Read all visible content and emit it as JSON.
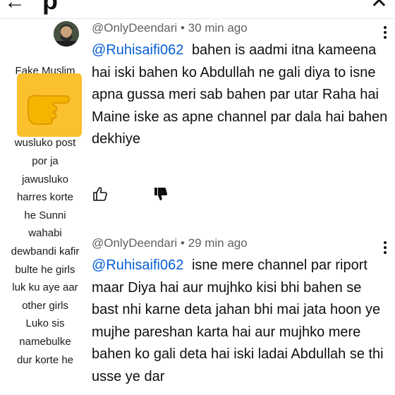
{
  "topbar": {
    "fragment": "p",
    "back_glyph": "←",
    "right_glyph": "✕"
  },
  "sidebar_lines": [
    "Fake Muslim",
    "wusluko post",
    "por ja",
    "jawusluko",
    "harres korte",
    "he Sunni",
    "wahabi",
    "dewbandi kafir",
    "bulte he girls",
    "luk ku aye aar",
    "other girls",
    "Luko sis",
    "namebulke",
    "dur korte he"
  ],
  "sticker": {
    "icon": "backhand-index-pointing-right-icon",
    "color": "#fbc02d"
  },
  "comments": [
    {
      "author": "@OnlyDeendari",
      "time": "30 min ago",
      "mention": "@Ruhisaifi062",
      "text": "bahen is aadmi itna kameena hai iski bahen ko Abdullah ne gali diya to isne apna gussa meri sab bahen par utar Raha hai Maine iske as apne channel par dala hai bahen dekhiye"
    },
    {
      "author": "@OnlyDeendari",
      "time": "29 min ago",
      "mention": "@Ruhisaifi062",
      "text": "isne mere channel par riport maar Diya hai aur mujhko kisi bhi bahen se bast nhi karne deta jahan bhi mai jata hoon ye mujhe pareshan karta hai aur mujhko mere bahen ko gali deta hai iski ladai Abdullah se thi usse ye dar"
    }
  ],
  "separator": " • ",
  "colors": {
    "mention": "#065fd4",
    "meta": "#606060",
    "text": "#0f0f0f"
  }
}
